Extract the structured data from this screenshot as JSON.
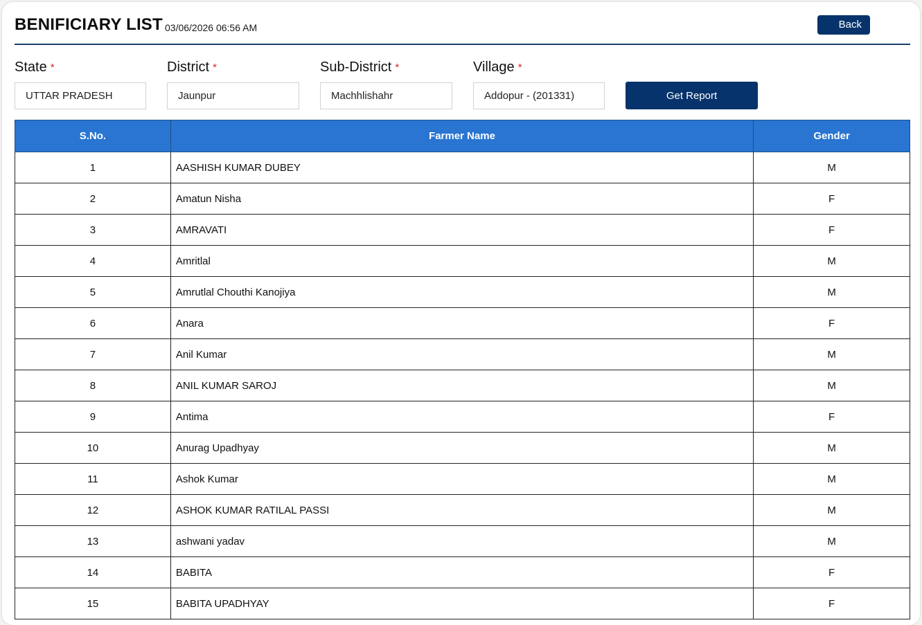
{
  "header": {
    "title": "BENIFICIARY LIST",
    "timestamp": "03/06/2026 06:56 AM",
    "back_label": "Back"
  },
  "filters": {
    "required_marker": "*",
    "state": {
      "label": "State",
      "value": "UTTAR PRADESH"
    },
    "district": {
      "label": "District",
      "value": "Jaunpur"
    },
    "sub_district": {
      "label": "Sub-District",
      "value": "Machhlishahr"
    },
    "village": {
      "label": "Village",
      "value": "Addopur - (201331)"
    },
    "get_report_label": "Get Report"
  },
  "table": {
    "columns": [
      "S.No.",
      "Farmer Name",
      "Gender"
    ],
    "rows": [
      [
        "1",
        "AASHISH KUMAR DUBEY",
        "M"
      ],
      [
        "2",
        "Amatun Nisha",
        "F"
      ],
      [
        "3",
        "AMRAVATI",
        "F"
      ],
      [
        "4",
        "Amritlal",
        "M"
      ],
      [
        "5",
        "Amrutlal Chouthi Kanojiya",
        "M"
      ],
      [
        "6",
        "Anara",
        "F"
      ],
      [
        "7",
        "Anil Kumar",
        "M"
      ],
      [
        "8",
        "ANIL KUMAR SAROJ",
        "M"
      ],
      [
        "9",
        "Antima",
        "F"
      ],
      [
        "10",
        "Anurag Upadhyay",
        "M"
      ],
      [
        "11",
        "Ashok Kumar",
        "M"
      ],
      [
        "12",
        "ASHOK KUMAR RATILAL PASSI",
        "M"
      ],
      [
        "13",
        "ashwani yadav",
        "M"
      ],
      [
        "14",
        "BABITA",
        "F"
      ],
      [
        "15",
        "BABITA UPADHYAY",
        "F"
      ]
    ]
  },
  "colors": {
    "header_bg": "#2975d1",
    "button_bg": "#06336b",
    "required": "#e02424"
  }
}
